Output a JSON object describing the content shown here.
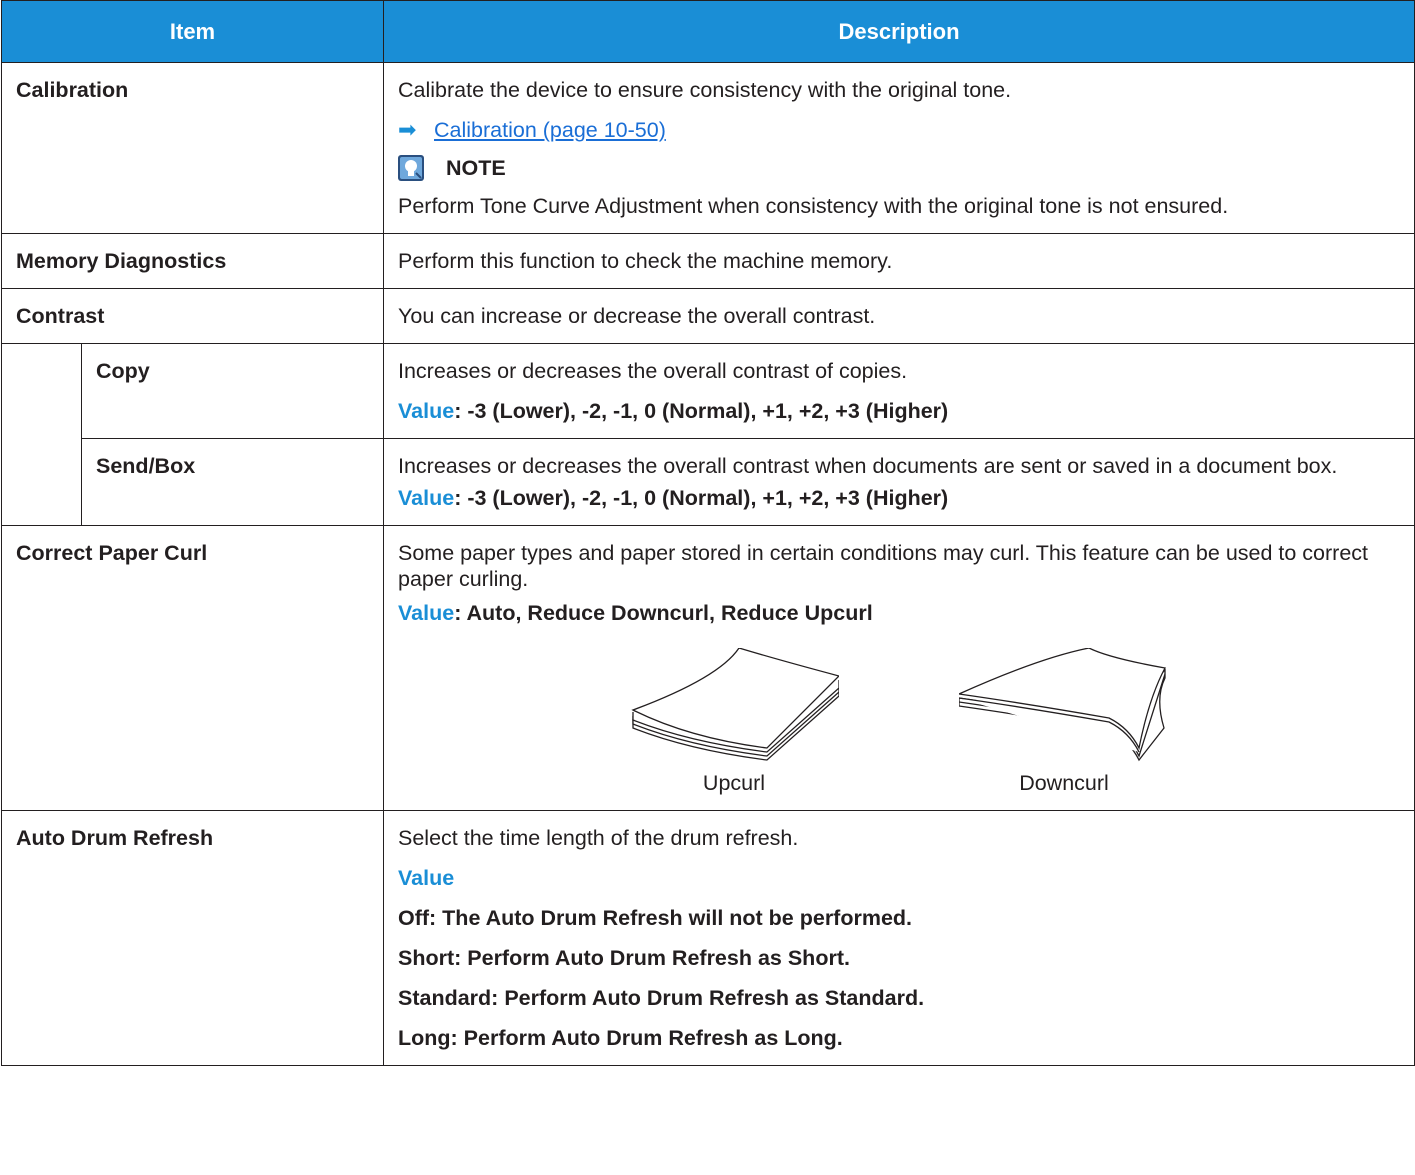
{
  "header": {
    "item": "Item",
    "description": "Description"
  },
  "rows": {
    "calibration": {
      "item": "Calibration",
      "desc": "Calibrate the device to ensure consistency with the original tone.",
      "link": "Calibration (page 10-50)",
      "note_title": "NOTE",
      "note_text": "Perform Tone Curve Adjustment when consistency with the original tone is not ensured."
    },
    "memory": {
      "item": "Memory Diagnostics",
      "desc": "Perform this function to check the machine memory."
    },
    "contrast": {
      "item": "Contrast",
      "desc": "You can increase or decrease the overall contrast."
    },
    "copy": {
      "item": "Copy",
      "desc": "Increases or decreases the overall contrast of copies.",
      "value_label": "Value",
      "value_text": ": -3 (Lower), -2, -1, 0 (Normal), +1, +2, +3 (Higher)"
    },
    "sendbox": {
      "item": "Send/Box",
      "desc": "Increases or decreases the overall contrast when documents are sent or saved in a document box.",
      "value_label": "Value",
      "value_text": ": -3 (Lower), -2, -1, 0 (Normal), +1, +2, +3 (Higher)"
    },
    "curl": {
      "item": "Correct Paper Curl",
      "desc": "Some paper types and paper stored in certain conditions may curl. This feature can be used to correct paper curling.",
      "value_label": "Value",
      "value_text": ": Auto, Reduce Downcurl, Reduce Upcurl",
      "fig_upcurl": "Upcurl",
      "fig_downcurl": "Downcurl"
    },
    "drum": {
      "item": "Auto Drum Refresh",
      "desc": "Select the time length of the drum refresh.",
      "value_label": "Value",
      "values": [
        "Off: The Auto Drum Refresh will not be performed.",
        "Short: Perform Auto Drum Refresh as Short.",
        "Standard: Perform Auto Drum Refresh as Standard.",
        "Long: Perform Auto Drum Refresh as Long."
      ]
    }
  }
}
